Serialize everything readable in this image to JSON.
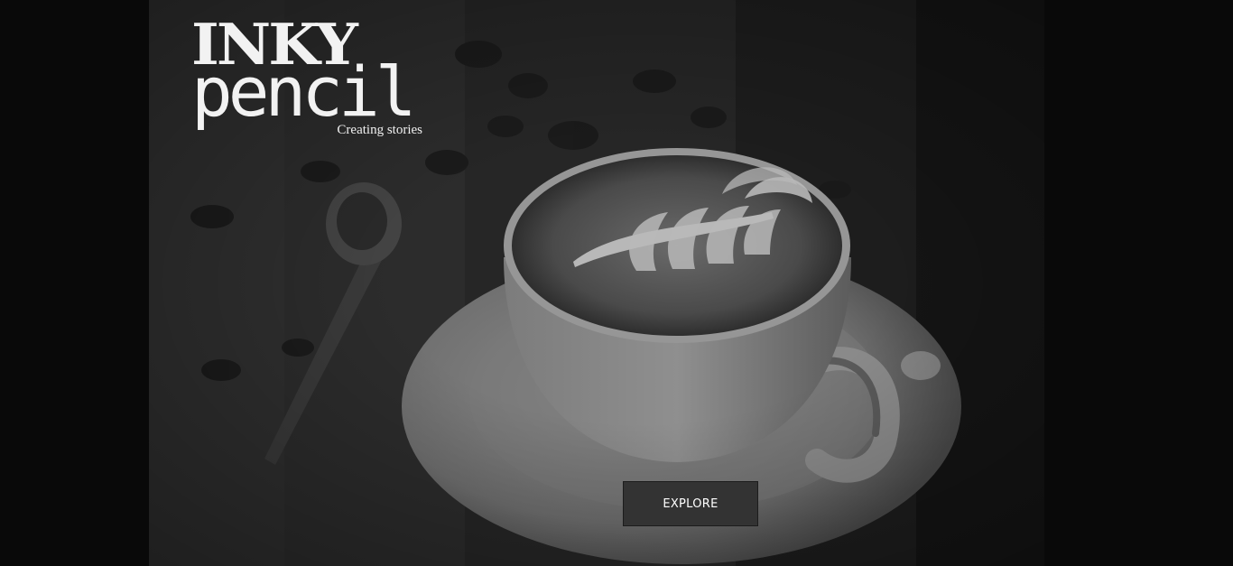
{
  "logo": {
    "line1": "INKY",
    "line2": "pencil",
    "tagline": "Creating stories"
  },
  "hero": {
    "image_subject": "latte-art-coffee-cup-on-saucer"
  },
  "cta": {
    "explore_label": "EXPLORE"
  },
  "colors": {
    "page_background": "#090909",
    "button_background": "#333333",
    "logo_text": "#f2f2f2"
  }
}
